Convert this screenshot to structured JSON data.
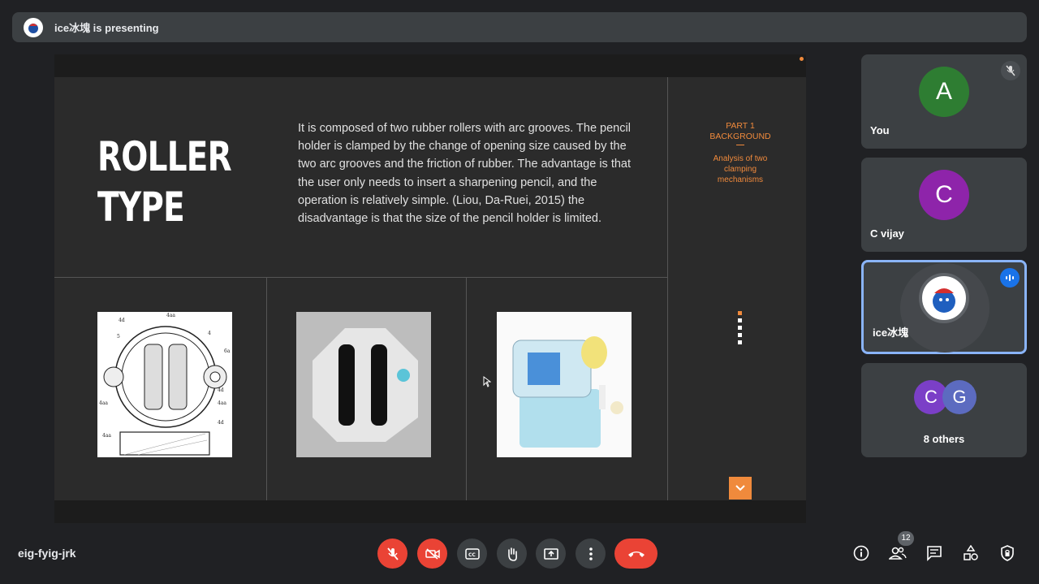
{
  "topbar": {
    "presenter_text": "ice冰塊 is presenting"
  },
  "slide": {
    "title_line1": "ROLLER",
    "title_line2": "TYPE",
    "body": "It is composed of two rubber rollers with arc grooves. The pencil holder is clamped by the change of opening size caused by the two arc grooves and the friction of rubber. The advantage is that the user only needs to insert a sharpening pencil, and the operation is relatively simple. (Liou, Da-Ruei, 2015) the disadvantage is that the size of the pencil holder is limited.",
    "side_part": "PART 1",
    "side_section": "BACKGROUND",
    "side_sub": "Analysis of two clamping mechanisms",
    "drawing_labels": [
      "4aa",
      "4d",
      "5",
      "4",
      "6a",
      "4aa",
      "4d",
      "4aa",
      "4aa",
      "4d"
    ],
    "accent_color": "#f08a3c"
  },
  "participants": [
    {
      "name": "You",
      "initial": "A",
      "color": "#2e7d32"
    },
    {
      "name": "C vijay",
      "initial": "C",
      "color": "#8e24aa"
    },
    {
      "name": "ice冰塊",
      "initial": "",
      "color": "#ffffff"
    },
    {
      "name": "8 others",
      "initial": "C",
      "initial2": "G",
      "color": "#7b3fc7",
      "color2": "#5c6bc0"
    }
  ],
  "bottom": {
    "meeting_code": "eig-fyig-jrk",
    "people_count": "12",
    "controls": [
      "mic-off-icon",
      "camera-off-icon",
      "captions-icon",
      "raise-hand-icon",
      "present-icon",
      "more-icon",
      "end-call-icon"
    ],
    "right_icons": [
      "info-icon",
      "people-icon",
      "chat-icon",
      "activities-icon",
      "host-controls-icon"
    ]
  }
}
